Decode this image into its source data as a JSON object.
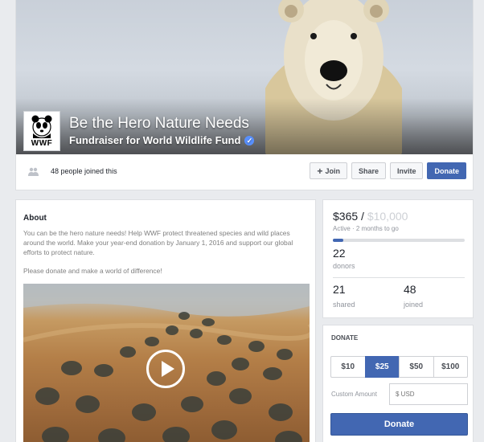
{
  "cover": {
    "title": "Be the Hero Nature Needs",
    "subtitle": "Fundraiser for World Wildlife Fund",
    "logo_text": "WWF"
  },
  "header": {
    "joined_text": "48 people joined this",
    "join_label": "Join",
    "share_label": "Share",
    "invite_label": "Invite",
    "donate_label": "Donate"
  },
  "about": {
    "title": "About",
    "text": "You can be the hero nature needs! Help WWF protect threatened species and wild places around the world. Make your year-end donation by January 1, 2016 and support our global efforts to protect nature.",
    "text2": "Please donate and make a world of difference!"
  },
  "progress": {
    "raised": "$365",
    "separator": " / ",
    "goal": "$10,000",
    "status": "Active · 2 months to go",
    "fraction": 0.0365,
    "donors_count": "22",
    "donors_label": "donors",
    "shared_count": "21",
    "shared_label": "shared",
    "joined_count": "48",
    "joined_label": "joined"
  },
  "donate": {
    "heading": "DONATE",
    "amounts": [
      "$10",
      "$25",
      "$50",
      "$100"
    ],
    "selected": "$25",
    "custom_label": "Custom Amount",
    "custom_placeholder": "$ USD",
    "button_label": "Donate"
  },
  "colors": {
    "brand_blue": "#4267b2",
    "background": "#e9ebee",
    "verified": "#5890ff"
  }
}
